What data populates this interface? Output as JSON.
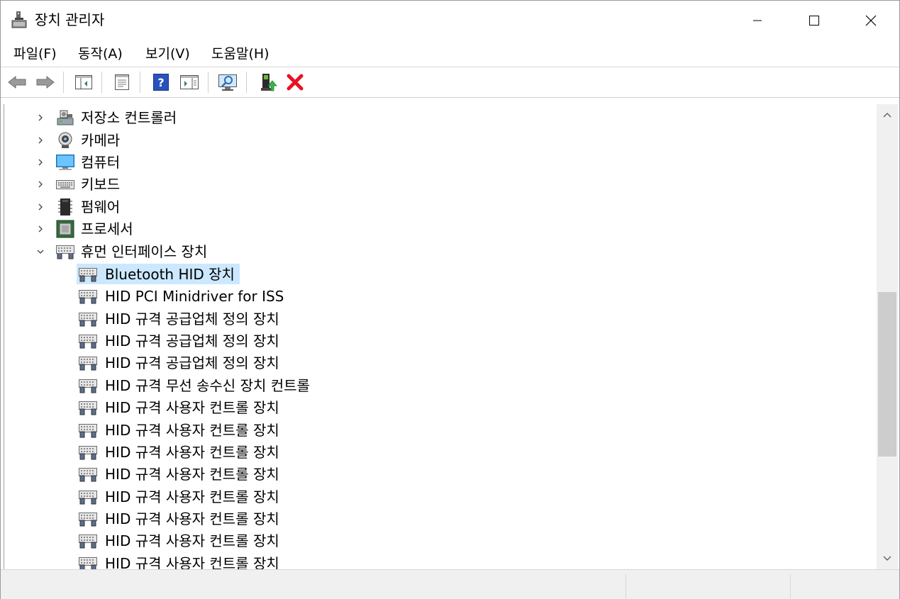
{
  "window": {
    "title": "장치 관리자",
    "minimize_icon": "minimize-icon",
    "maximize_icon": "maximize-icon",
    "close_icon": "close-icon"
  },
  "menu": {
    "items": [
      {
        "label": "파일(F)"
      },
      {
        "label": "동작(A)"
      },
      {
        "label": "보기(V)"
      },
      {
        "label": "도움말(H)"
      }
    ]
  },
  "toolbar": {
    "buttons": [
      "back-icon",
      "forward-icon",
      "show-hide-console-tree-icon",
      "properties-icon",
      "help-icon",
      "show-action-pane-icon",
      "scan-hardware-icon",
      "update-driver-icon",
      "uninstall-device-icon"
    ]
  },
  "tree": {
    "categories": [
      {
        "label": "저장소 컨트롤러",
        "icon": "storage-controller-icon",
        "expanded": false
      },
      {
        "label": "카메라",
        "icon": "camera-icon",
        "expanded": false
      },
      {
        "label": "컴퓨터",
        "icon": "computer-icon",
        "expanded": false
      },
      {
        "label": "키보드",
        "icon": "keyboard-icon",
        "expanded": false
      },
      {
        "label": "펌웨어",
        "icon": "firmware-icon",
        "expanded": false
      },
      {
        "label": "프로세서",
        "icon": "processor-icon",
        "expanded": false
      },
      {
        "label": "휴먼 인터페이스 장치",
        "icon": "hid-icon",
        "expanded": true
      }
    ],
    "hid_devices": [
      {
        "label": "Bluetooth HID 장치",
        "selected": true
      },
      {
        "label": "HID PCI Minidriver for ISS"
      },
      {
        "label": "HID 규격 공급업체 정의 장치"
      },
      {
        "label": "HID 규격 공급업체 정의 장치"
      },
      {
        "label": "HID 규격 공급업체 정의 장치"
      },
      {
        "label": "HID 규격 무선 송수신 장치 컨트롤"
      },
      {
        "label": "HID 규격 사용자 컨트롤 장치"
      },
      {
        "label": "HID 규격 사용자 컨트롤 장치"
      },
      {
        "label": "HID 규격 사용자 컨트롤 장치"
      },
      {
        "label": "HID 규격 사용자 컨트롤 장치"
      },
      {
        "label": "HID 규격 사용자 컨트롤 장치"
      },
      {
        "label": "HID 규격 사용자 컨트롤 장치"
      },
      {
        "label": "HID 규격 사용자 컨트롤 장치"
      },
      {
        "label": "HID 규격 사용자 컨트롤 장치"
      }
    ]
  },
  "colors": {
    "selection": "#cce8ff",
    "scroll_track": "#f0f0f0",
    "scroll_thumb": "#cdcdcd",
    "uninstall_red": "#e81123"
  }
}
